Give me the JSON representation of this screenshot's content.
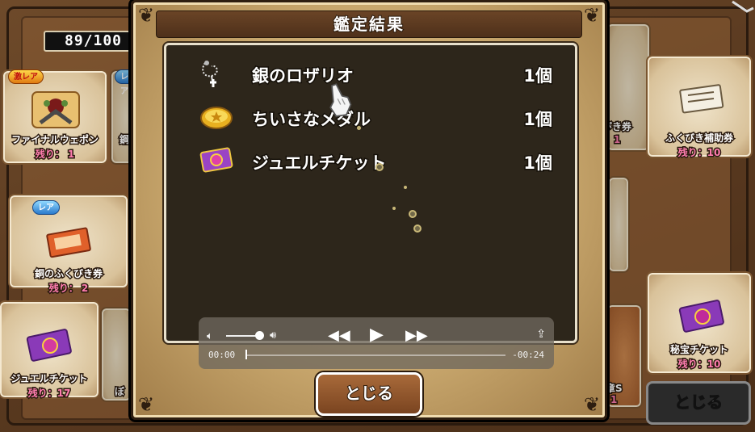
{
  "background": {
    "counter": "89/100",
    "close_label": "とじる",
    "cards": [
      {
        "name": "ファイナルウェポン",
        "remain": "残り： 1",
        "rarity": "激レア"
      },
      {
        "name": "鋼",
        "remain": "",
        "rarity": "レア"
      },
      {
        "name": "銅のふくびき券",
        "remain": "残り： 2",
        "rarity": "レア"
      },
      {
        "name": "ジュエルチケット",
        "remain": "残り：17",
        "rarity": ""
      },
      {
        "name": "ぼ",
        "remain": "",
        "rarity": ""
      },
      {
        "name": "びき券",
        "remain": "1",
        "rarity": ""
      },
      {
        "name": "ふくびき補助券",
        "remain": "残り：10",
        "rarity": ""
      },
      {
        "name": "秘宝チケット",
        "remain": "残り：10",
        "rarity": ""
      },
      {
        "name": "章S",
        "remain": "1",
        "rarity": ""
      }
    ]
  },
  "modal": {
    "title": "鑑定結果",
    "items": [
      {
        "name": "銀のロザリオ",
        "qty": "1個",
        "icon": "rosary-icon"
      },
      {
        "name": "ちいさなメダル",
        "qty": "1個",
        "icon": "medal-icon"
      },
      {
        "name": "ジュエルチケット",
        "qty": "1個",
        "icon": "jewel-ticket-icon"
      }
    ],
    "close_label": "とじる"
  },
  "player": {
    "time_elapsed": "00:00",
    "time_remaining": "-00:24",
    "progress": 0.0,
    "volume": 0.85
  },
  "colors": {
    "modal_bg": "#c9a86e",
    "results_bg": "#2d261b",
    "remain_pink": "#ff7db0"
  }
}
